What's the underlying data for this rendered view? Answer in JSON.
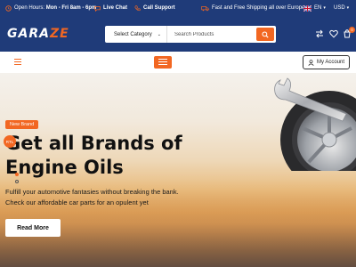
{
  "topbar": {
    "hours_label": "Open Hours:",
    "hours_value": "Mon - Fri 8am - 6pm",
    "live_chat": "Live Chat",
    "call_support": "Call Support",
    "shipping": "Fast and Free Shipping all over Europe",
    "language": "EN",
    "currency": "USD"
  },
  "header": {
    "logo_main": "GARA",
    "logo_accent": "ZE",
    "category_label": "Select Category",
    "search_placeholder": "Search Products",
    "cart_count": "0"
  },
  "nav": {
    "account_label": "My Account"
  },
  "hero": {
    "badge": "New Brand",
    "rtl": "RTL",
    "title_line1": "Get all Brands of",
    "title_line2": "Engine Oils",
    "subtitle_line1": "Fulfill your automotive fantasies without breaking the bank.",
    "subtitle_line2": "Check our affordable car parts for an opulent yet",
    "button": "Read More"
  },
  "colors": {
    "brand_blue": "#1f3b79",
    "accent_orange": "#f26722"
  },
  "icons": [
    "clock-icon",
    "chat-icon",
    "phone-icon",
    "truck-icon",
    "uk-flag-icon",
    "search-icon",
    "compare-icon",
    "heart-icon",
    "cart-icon",
    "hamburger-icon",
    "menu-icon",
    "user-icon"
  ]
}
